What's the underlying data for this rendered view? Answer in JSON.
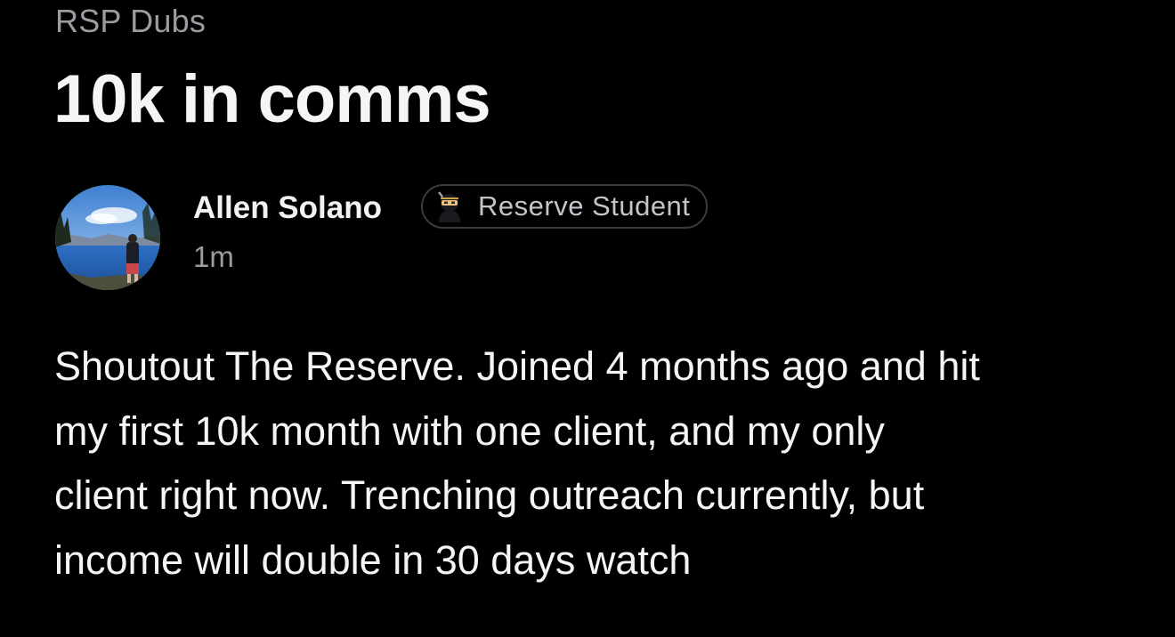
{
  "post": {
    "category": "RSP Dubs",
    "title": "10k in comms",
    "author": {
      "name": "Allen Solano",
      "avatar_icon": "profile-photo-lake",
      "badge": {
        "icon": "ninja-emoji-icon",
        "label": "Reserve Student"
      }
    },
    "timestamp": "1m",
    "body_lines": [
      "Shoutout The Reserve. Joined 4 months ago and hit",
      "my first 10k month with one client, and my only",
      "client right now. Trenching outreach currently, but",
      "income will double in 30 days watch"
    ]
  },
  "colors": {
    "background": "#000000",
    "primary_text": "#f5f5f7",
    "secondary_text": "#9b9ba1",
    "badge_border": "#3b3b40"
  }
}
